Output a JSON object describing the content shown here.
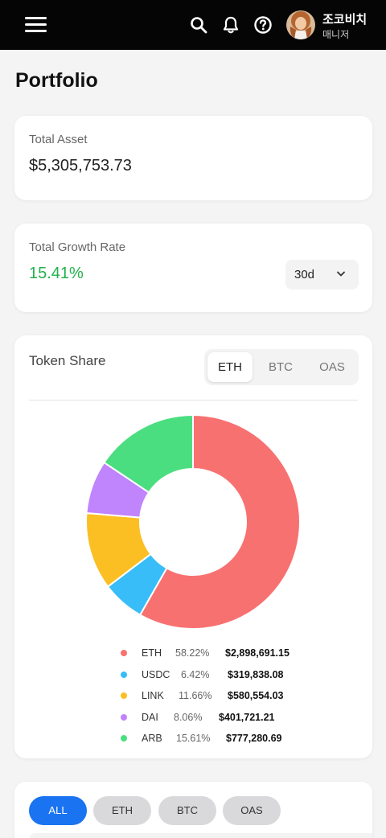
{
  "header": {
    "user_name": "조코비치",
    "user_role": "매니저"
  },
  "page_title": "Portfolio",
  "total_asset": {
    "label": "Total Asset",
    "value": "$5,305,753.73"
  },
  "growth": {
    "label": "Total Growth Rate",
    "value": "15.41%",
    "period": "30d",
    "value_color": "#22b14c"
  },
  "token_share": {
    "title": "Token Share",
    "tabs": [
      "ETH",
      "BTC",
      "OAS"
    ],
    "active_tab": "ETH"
  },
  "chart_data": {
    "type": "pie",
    "categories": [
      "ETH",
      "USDC",
      "LINK",
      "DAI",
      "ARB"
    ],
    "values": [
      58.22,
      6.42,
      11.66,
      8.06,
      15.61
    ],
    "amounts": [
      "$2,898,691.15",
      "$319,838.08",
      "$580,554.03",
      "$401,721.21",
      "$777,280.69"
    ],
    "percent_labels": [
      "58.22%",
      "6.42%",
      "11.66%",
      "8.06%",
      "15.61%"
    ],
    "colors": [
      "#f87171",
      "#38bdf8",
      "#fbbf24",
      "#c084fc",
      "#4ade80"
    ],
    "donut": true
  },
  "filters": {
    "items": [
      "ALL",
      "ETH",
      "BTC",
      "OAS"
    ],
    "active": "ALL"
  }
}
